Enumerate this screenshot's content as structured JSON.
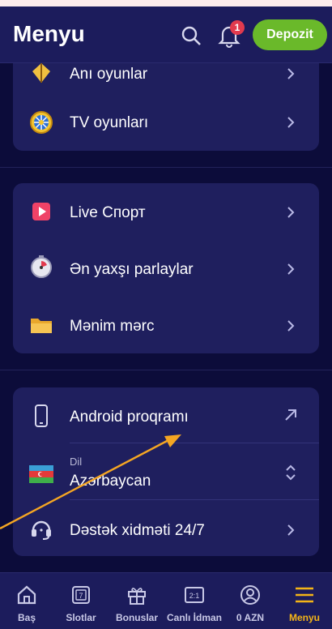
{
  "header": {
    "title": "Menyu",
    "notification_count": "1",
    "deposit_label": "Depozit"
  },
  "menu_group_1": [
    {
      "label": "Anı oyunlar",
      "icon": "kite-icon"
    },
    {
      "label": "TV oyunları",
      "icon": "wheel-icon"
    }
  ],
  "menu_group_2": [
    {
      "label": "Live Спорт",
      "icon": "play-icon"
    },
    {
      "label": "Ən yaxşı parlaylar",
      "icon": "stopwatch-icon"
    },
    {
      "label": "Mənim mərc",
      "icon": "folder-icon"
    }
  ],
  "menu_group_3": {
    "android": {
      "label": "Android proqramı",
      "icon": "phone-icon"
    },
    "language": {
      "sublabel": "Dil",
      "value": "Azərbaycan",
      "icon": "azerbaijan-flag-icon"
    },
    "support": {
      "label": "Dəstək xidməti 24/7",
      "icon": "headset-icon"
    }
  },
  "bottom_nav": [
    {
      "label": "Baş",
      "icon": "home-icon"
    },
    {
      "label": "Slotlar",
      "icon": "slot-icon"
    },
    {
      "label": "Bonuslar",
      "icon": "gift-icon"
    },
    {
      "label": "Canlı İdman",
      "icon": "scoreboard-icon"
    },
    {
      "label": "0 AZN",
      "icon": "user-icon"
    },
    {
      "label": "Menyu",
      "icon": "hamburger-icon",
      "active": true
    }
  ],
  "colors": {
    "background": "#0c0c3a",
    "header": "#1c1c5c",
    "card": "#1f1f5e",
    "deposit": "#6ab92a",
    "badge": "#e23a4e",
    "active_nav": "#f4b417",
    "annotation_arrow": "#f5a623"
  }
}
